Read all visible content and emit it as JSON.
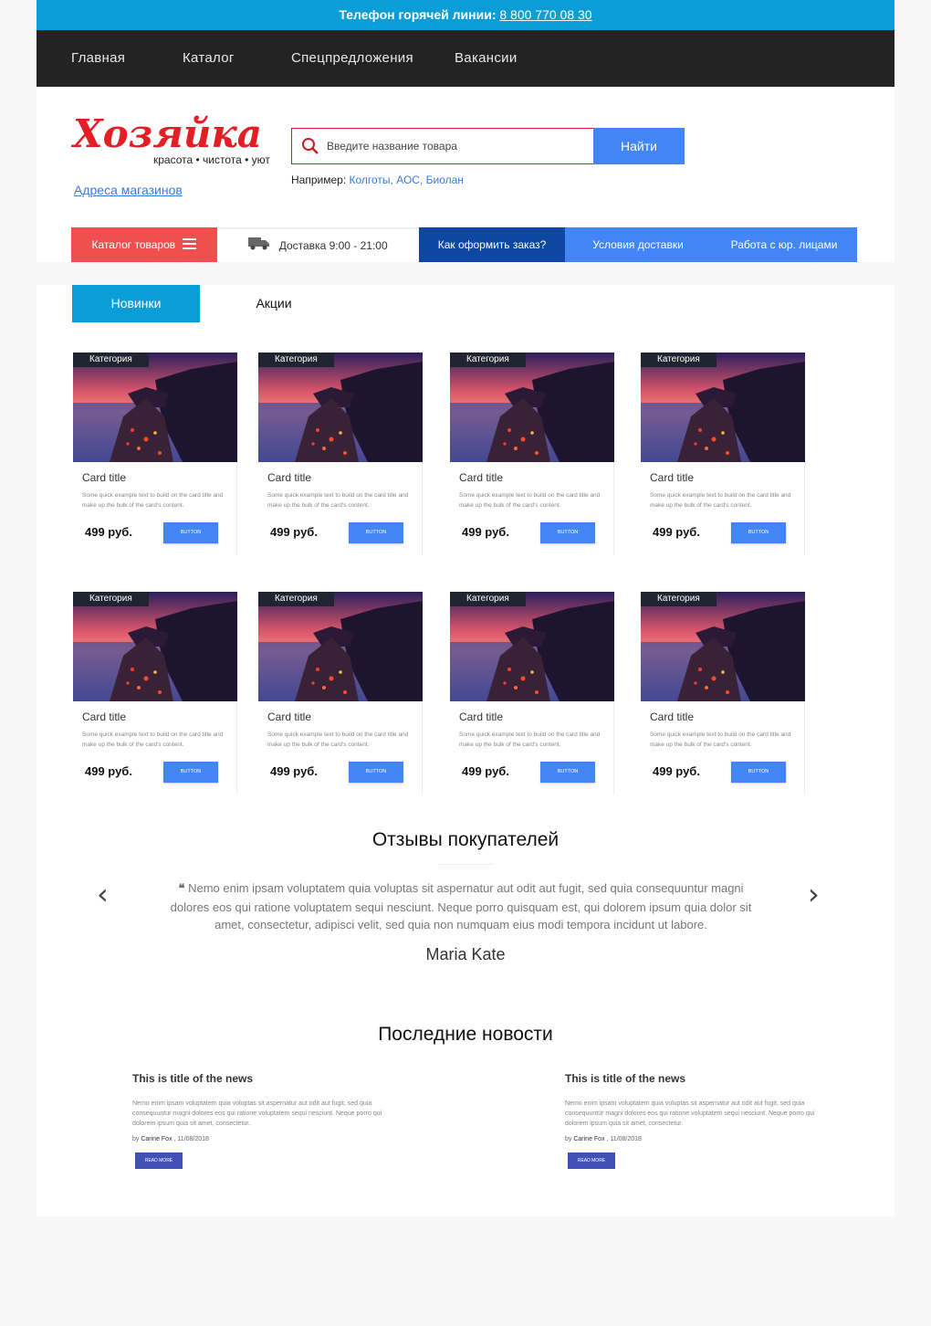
{
  "topbar": {
    "label": "Телефон горячей линии:",
    "phone": "8 800 770 08 30"
  },
  "nav": {
    "items": [
      "Главная",
      "Каталог",
      "Спецпредложения",
      "Вакансии"
    ]
  },
  "header": {
    "logo_text": "Хозяйка",
    "logo_tagline": "красота • чистота • уют",
    "stores_link": "Адреса магазинов",
    "search_placeholder": "Введите название товара",
    "search_button": "Найти",
    "example_label": "Например:",
    "example_links": "Колготы, АОС, Биолан"
  },
  "subnav": {
    "catalog": "Каталог товаров",
    "delivery": "Доставка 9:00 - 21:00",
    "how_to_order": "Как оформить заказ?",
    "delivery_terms": "Условия доставки",
    "legal": "Работа с юр. лицами"
  },
  "tabs": [
    "Новинки",
    "Акции"
  ],
  "cards": [
    {
      "badge": "Категория",
      "title": "Card title",
      "text": "Some quick example text to build on the card title and make up the bulk of the card's content.",
      "price": "499 руб.",
      "button": "BUTTON"
    },
    {
      "badge": "Категория",
      "title": "Card title",
      "text": "Some quick example text to build on the card title and make up the bulk of the card's content.",
      "price": "499 руб.",
      "button": "BUTTON"
    },
    {
      "badge": "Категория",
      "title": "Card title",
      "text": "Some quick example text to build on the card title and make up the bulk of the card's content.",
      "price": "499 руб.",
      "button": "BUTTON"
    },
    {
      "badge": "Категория",
      "title": "Card title",
      "text": "Some quick example text to build on the card title and make up the bulk of the card's content.",
      "price": "499 руб.",
      "button": "BUTTON"
    },
    {
      "badge": "Категория",
      "title": "Card title",
      "text": "Some quick example text to build on the card title and make up the bulk of the card's content.",
      "price": "499 руб.",
      "button": "BUTTON"
    },
    {
      "badge": "Категория",
      "title": "Card title",
      "text": "Some quick example text to build on the card title and make up the bulk of the card's content.",
      "price": "499 руб.",
      "button": "BUTTON"
    },
    {
      "badge": "Категория",
      "title": "Card title",
      "text": "Some quick example text to build on the card title and make up the bulk of the card's content.",
      "price": "499 руб.",
      "button": "BUTTON"
    },
    {
      "badge": "Категория",
      "title": "Card title",
      "text": "Some quick example text to build on the card title and make up the bulk of the card's content.",
      "price": "499 руб.",
      "button": "BUTTON"
    }
  ],
  "reviews": {
    "title": "Отзывы покупателей",
    "text": "Nemo enim ipsam voluptatem quia voluptas sit aspernatur aut odit aut fugit, sed quia consequuntur magni dolores eos qui ratione voluptatem sequi nesciunt. Neque porro quisquam est, qui dolorem ipsum quia dolor sit amet, consectetur, adipisci velit, sed quia non numquam eius modi tempora incidunt ut labore.",
    "author": "Maria Kate",
    "prev": "‹",
    "next": "›"
  },
  "news": {
    "title": "Последние новости",
    "items": [
      {
        "title": "This is title of the news",
        "text": "Nemo enim ipsam voluptatem quia voluptas sit aspernatur aut odit aut fugit, sed quia consequuntur magni dolores eos qui ratione voluptatem sequi nesciunt. Neque porro qui dolorem ipsum quia sit amet, consectetur.",
        "author": "Carine Fox",
        "date": "11/08/2018",
        "button": "READ MORE"
      },
      {
        "title": "This is title of the news",
        "text": "Nemo enim ipsam voluptatem quia voluptas sit aspernatur aut odit aut fugit, sed quia consequuntur magni dolores eos qui ratione voluptatem sequi nesciunt. Neque porro qui dolorem ipsum quia sit amet, consectetur.",
        "author": "Carine Fox",
        "date": "11/08/2018",
        "button": "READ MORE"
      }
    ]
  },
  "colors": {
    "topbar": "#0b9ed6",
    "nav": "#232323",
    "brand_red": "#e31e24",
    "accent_blue": "#4285f4",
    "dark_blue": "#0d47a1",
    "catalog_red": "#f04f4f"
  },
  "icons": [
    "search-icon",
    "menu-icon",
    "truck-icon",
    "quote-icon",
    "chevron-left-icon",
    "chevron-right-icon"
  ]
}
